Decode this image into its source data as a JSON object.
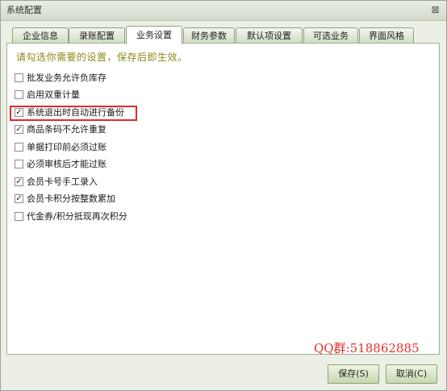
{
  "window": {
    "title": "系统配置",
    "close_glyph": "⊠"
  },
  "tabs": [
    {
      "label": "企业信息",
      "active": false
    },
    {
      "label": "录账配置",
      "active": false
    },
    {
      "label": "业务设置",
      "active": true
    },
    {
      "label": "财务参数",
      "active": false
    },
    {
      "label": "默认项设置",
      "active": false
    },
    {
      "label": "可选业务",
      "active": false
    },
    {
      "label": "界面风格",
      "active": false
    }
  ],
  "panel": {
    "hint": "请勾选你需要的设置，保存后即生效。",
    "options": [
      {
        "label": "批发业务允许负库存",
        "checked": false
      },
      {
        "label": "启用双重计量",
        "checked": false
      },
      {
        "label": "系统退出时自动进行备份",
        "checked": true,
        "highlighted": true
      },
      {
        "label": "商品条码不允许重复",
        "checked": true
      },
      {
        "label": "单据打印前必须过账",
        "checked": false
      },
      {
        "label": "必须审核后才能过账",
        "checked": false
      },
      {
        "label": "会员卡号手工录入",
        "checked": true
      },
      {
        "label": "会员卡积分按整数累加",
        "checked": true
      },
      {
        "label": "代金券/积分抵现再次积分",
        "checked": false
      }
    ]
  },
  "watermark": {
    "text": "QQ群:518862885",
    "color": "#e8302a"
  },
  "footer": {
    "save_label": "保存(S)",
    "cancel_label": "取消(C)"
  },
  "colors": {
    "window_bg": "#ebefe6",
    "highlight_border": "#e02a2a",
    "hint_text": "#8a8a1a"
  }
}
